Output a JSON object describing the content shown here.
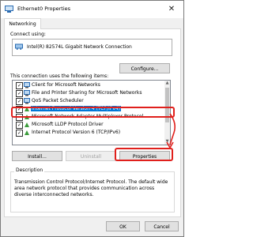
{
  "window": {
    "title": "Ethernet0 Properties",
    "close_glyph": "✕"
  },
  "tabs": [
    {
      "label": "Networking",
      "active": true
    }
  ],
  "connect": {
    "label": "Connect using:",
    "adapter": "Intel(R) 82574L Gigabit Network Connection",
    "configure_label": "Configure..."
  },
  "items_label": "This connection uses the following items:",
  "items": [
    {
      "label": "Client for Microsoft Networks",
      "checked": true,
      "icon": "network-client-icon"
    },
    {
      "label": "File and Printer Sharing for Microsoft Networks",
      "checked": true,
      "icon": "network-service-icon"
    },
    {
      "label": "QoS Packet Scheduler",
      "checked": true,
      "icon": "network-service-icon"
    },
    {
      "label": "Internet Protocol Version 4 (TCP/IPv4)",
      "checked": true,
      "selected": true,
      "icon": "protocol-icon"
    },
    {
      "label": "Microsoft Network Adapter Multiplexor Protocol",
      "checked": false,
      "icon": "protocol-icon"
    },
    {
      "label": "Microsoft LLDP Protocol Driver",
      "checked": true,
      "icon": "protocol-icon"
    },
    {
      "label": "Internet Protocol Version 6 (TCP/IPv6)",
      "checked": true,
      "icon": "protocol-icon"
    }
  ],
  "buttons": {
    "install": "Install...",
    "uninstall": "Uninstall",
    "properties": "Properties",
    "ok": "OK",
    "cancel": "Cancel"
  },
  "description": {
    "title": "Description",
    "text": "Transmission Control Protocol/Internet Protocol. The default wide area network protocol that provides communication across diverse interconnected networks."
  },
  "colors": {
    "selection": "#0078d7",
    "highlight": "#e0201c"
  },
  "check_glyph": "✓"
}
